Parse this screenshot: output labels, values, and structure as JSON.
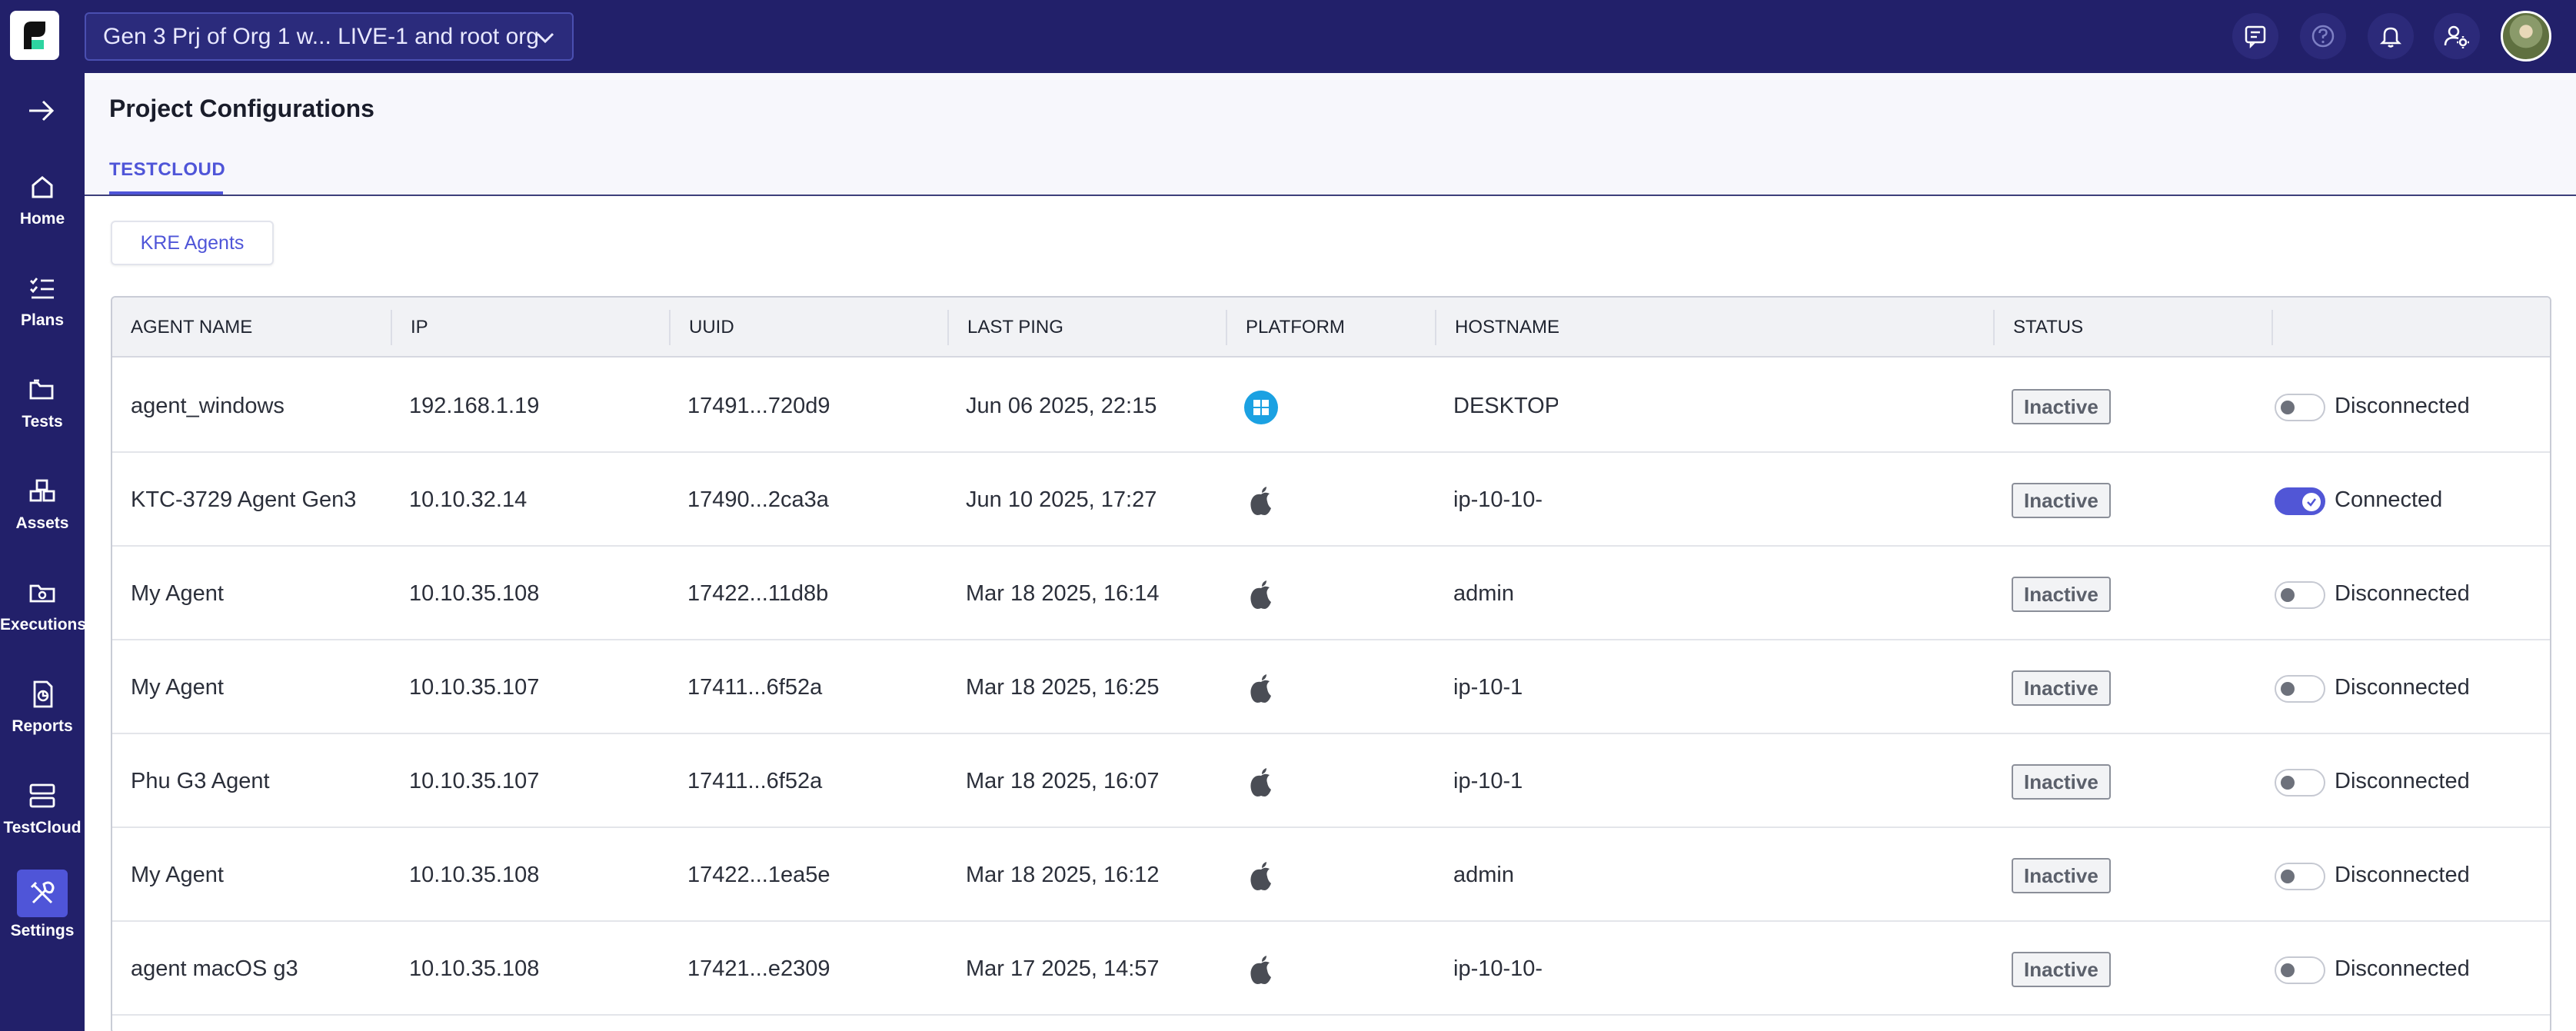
{
  "header": {
    "project_selector": "Gen 3 Prj of Org 1 w... LIVE-1 and root org"
  },
  "sidebar": {
    "items": [
      {
        "label": "Home",
        "icon": "home-icon"
      },
      {
        "label": "Plans",
        "icon": "checklist-icon"
      },
      {
        "label": "Tests",
        "icon": "folder-icon"
      },
      {
        "label": "Assets",
        "icon": "assets-icon"
      },
      {
        "label": "Executions",
        "icon": "executions-icon"
      },
      {
        "label": "Reports",
        "icon": "report-icon"
      },
      {
        "label": "TestCloud",
        "icon": "server-icon"
      },
      {
        "label": "Settings",
        "icon": "settings-icon",
        "active": true
      }
    ]
  },
  "page": {
    "title": "Project Configurations",
    "tab": "TESTCLOUD",
    "subtab": "KRE Agents"
  },
  "table": {
    "headers": [
      "AGENT NAME",
      "IP",
      "UUID",
      "LAST PING",
      "PLATFORM",
      "HOSTNAME",
      "STATUS"
    ],
    "rows": [
      {
        "name": "agent_windows",
        "ip": "192.168.1.19",
        "uuid": "17491...720d9",
        "last_ping": "Jun 06 2025, 22:15",
        "platform": "windows",
        "hostname": "DESKTOP-",
        "status": "Inactive",
        "connected": false,
        "connection": "Disconnected"
      },
      {
        "name": "KTC-3729 Agent Gen3",
        "ip": "10.10.32.14",
        "uuid": "17490...2ca3a",
        "last_ping": "Jun 10 2025, 17:27",
        "platform": "apple",
        "hostname": "ip-10-10-",
        "status": "Inactive",
        "connected": true,
        "connection": "Connected"
      },
      {
        "name": "My Agent",
        "ip": "10.10.35.108",
        "uuid": "17422...11d8b",
        "last_ping": "Mar 18 2025, 16:14",
        "platform": "apple",
        "hostname": "admin",
        "status": "Inactive",
        "connected": false,
        "connection": "Disconnected"
      },
      {
        "name": "My Agent",
        "ip": "10.10.35.107",
        "uuid": "17411...6f52a",
        "last_ping": "Mar 18 2025, 16:25",
        "platform": "apple",
        "hostname": "ip-10-1",
        "status": "Inactive",
        "connected": false,
        "connection": "Disconnected"
      },
      {
        "name": "Phu G3 Agent",
        "ip": "10.10.35.107",
        "uuid": "17411...6f52a",
        "last_ping": "Mar 18 2025, 16:07",
        "platform": "apple",
        "hostname": "ip-10-1",
        "status": "Inactive",
        "connected": false,
        "connection": "Disconnected"
      },
      {
        "name": "My Agent",
        "ip": "10.10.35.108",
        "uuid": "17422...1ea5e",
        "last_ping": "Mar 18 2025, 16:12",
        "platform": "apple",
        "hostname": "admin",
        "status": "Inactive",
        "connected": false,
        "connection": "Disconnected"
      },
      {
        "name": "agent macOS g3",
        "ip": "10.10.35.108",
        "uuid": "17421...e2309",
        "last_ping": "Mar 17 2025, 14:57",
        "platform": "apple",
        "hostname": "ip-10-10-",
        "status": "Inactive",
        "connected": false,
        "connection": "Disconnected"
      }
    ]
  },
  "colors": {
    "nav_bg": "#22206a",
    "accent": "#4f55d8",
    "windows_blue": "#1ba1e2"
  }
}
